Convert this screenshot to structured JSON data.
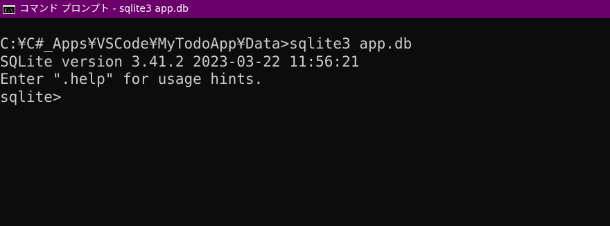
{
  "window": {
    "title": "コマンド プロンプト - sqlite3  app.db",
    "icon": "cmd-icon",
    "colors": {
      "titlebar": "#6b006b",
      "background": "#0c0c0c",
      "text": "#cccccc"
    }
  },
  "console": {
    "lines": [
      "C:¥C#_Apps¥VSCode¥MyTodoApp¥Data>sqlite3 app.db",
      "SQLite version 3.41.2 2023-03-22 11:56:21",
      "Enter \".help\" for usage hints.",
      "sqlite>"
    ]
  }
}
